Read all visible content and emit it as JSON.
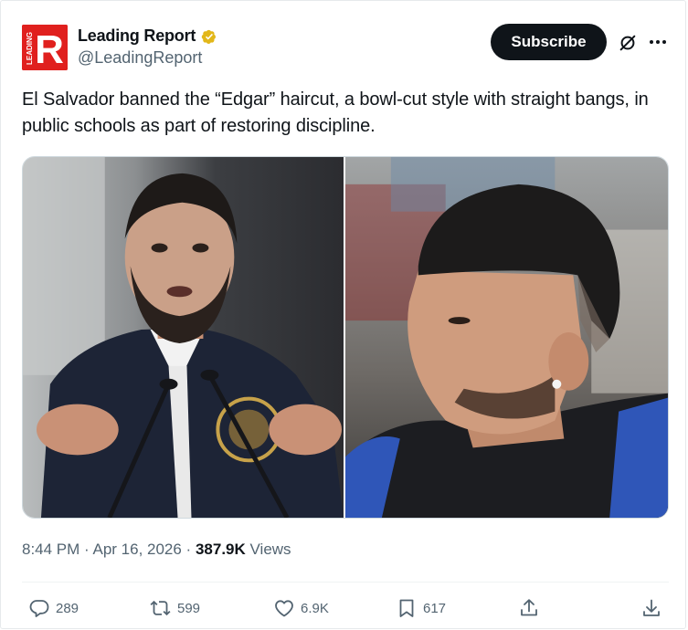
{
  "account": {
    "name": "Leading Report",
    "handle": "@LeadingReport",
    "avatar_letter": "R",
    "avatar_vertical_text": "LEADING"
  },
  "header": {
    "subscribe_label": "Subscribe"
  },
  "post": {
    "text": "El Salvador banned the “Edgar” haircut, a bowl-cut style with straight bangs, in public schools as part of restoring discipline.",
    "time": "8:44 PM · Apr 16, 2026 · ",
    "views_count": "387.9K",
    "views_label": " Views"
  },
  "actions": {
    "replies": "289",
    "reposts": "599",
    "likes": "6.9K",
    "bookmarks": "617"
  },
  "colors": {
    "brand_red": "#e0201e",
    "verified_gold": "#e2b719",
    "text_primary": "#0f1419",
    "text_secondary": "#536471"
  },
  "icons": [
    "verified-badge-icon",
    "grok-icon",
    "more-icon",
    "reply-icon",
    "repost-icon",
    "like-icon",
    "bookmark-icon",
    "share-icon",
    "download-icon"
  ]
}
